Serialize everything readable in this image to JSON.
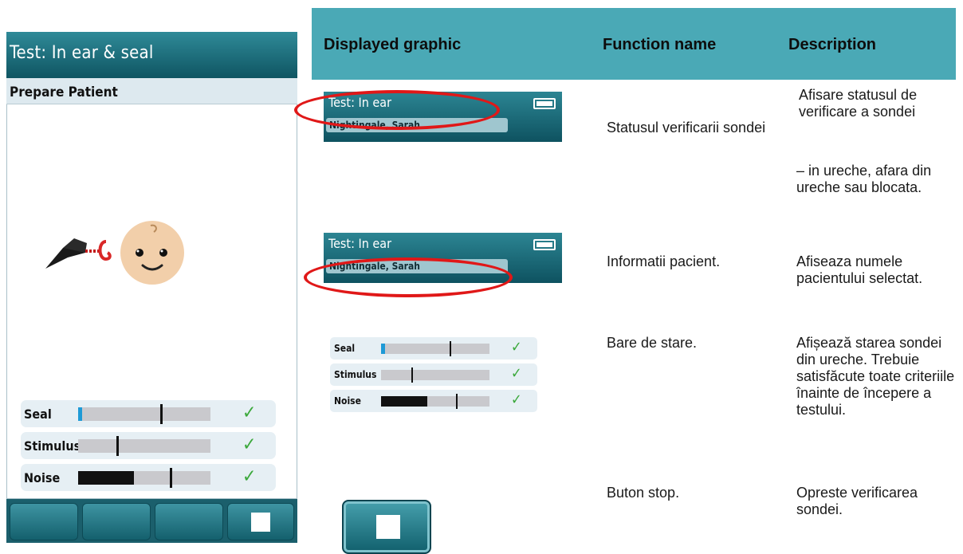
{
  "device": {
    "title": "Test: In ear & seal",
    "subtitle": "Prepare Patient",
    "bars": [
      {
        "label": "Seal",
        "fill_color": "#1e9ad6",
        "fill_fraction": 0.03,
        "marker_fraction": 0.62,
        "status": "✓"
      },
      {
        "label": "Stimulus",
        "fill_color": "#9b4fae",
        "fill_fraction": 0.0,
        "marker_fraction": 0.29,
        "status": "✓",
        "label_fill_color": "#9b4fae"
      },
      {
        "label": "Noise",
        "fill_color": "#111111",
        "fill_fraction": 0.42,
        "marker_fraction": 0.69,
        "status": "✓"
      }
    ],
    "buttons": [
      "",
      "",
      "",
      "stop"
    ]
  },
  "table": {
    "headers": [
      "Displayed graphic",
      "Function name",
      "Description"
    ],
    "rows": [
      {
        "graphic": {
          "title": "Test: In ear",
          "patient": "Nightingale, Sarah"
        },
        "function": "Statusul verificarii sondei",
        "description": "Afisare statusul de verificare a sondei",
        "description_extra": "– in ureche, afara din ureche sau blocata."
      },
      {
        "graphic": {
          "title": "Test: In ear",
          "patient": "Nightingale, Sarah"
        },
        "function": "Informatii pacient.",
        "description": "Afiseaza numele pacientului selectat."
      },
      {
        "graphic": {
          "bars": [
            {
              "label": "Seal",
              "fill_color": "#1e9ad6",
              "fill_fraction": 0.04,
              "marker_fraction": 0.63,
              "status": "✓"
            },
            {
              "label": "Stimulus",
              "fill_color": "#9b4fae",
              "fill_fraction": 0.0,
              "marker_fraction": 0.28,
              "status": "✓"
            },
            {
              "label": "Noise",
              "fill_color": "#111111",
              "fill_fraction": 0.43,
              "marker_fraction": 0.69,
              "status": "✓"
            }
          ]
        },
        "function": "Bare de stare.",
        "description": "Afișează starea sondei din ureche. Trebuie satisfăcute toate criteriile înainte de începere a testului."
      },
      {
        "graphic": {
          "button": "stop"
        },
        "function": "Buton stop.",
        "description": "Opreste verificarea sondei."
      }
    ]
  },
  "colors": {
    "header_teal": "#4aa9b6",
    "screen_teal": "#0f5562",
    "highlight_red": "#e01818",
    "check_green": "#3aa83a"
  }
}
